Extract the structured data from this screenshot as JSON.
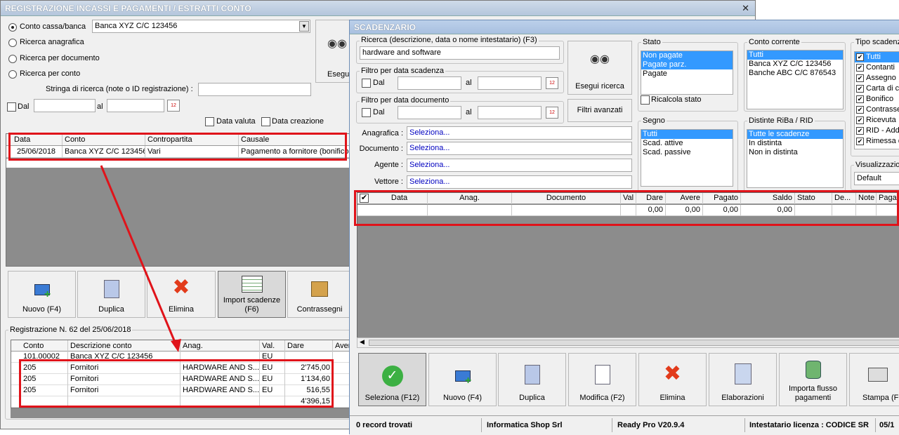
{
  "left_window": {
    "title": "REGISTRAZIONE INCASSI E PAGAMENTI / ESTRATTI CONTO",
    "radios": [
      "Conto cassa/banca",
      "Ricerca anagrafica",
      "Ricerca per documento",
      "Ricerca per conto"
    ],
    "conto_select": "Banca XYZ C/C 123456",
    "search_label": "Stringa di ricerca (note o ID registrazione) :",
    "dal": "Dal",
    "al": "al",
    "data_valuta": "Data valuta",
    "data_creazione": "Data creazione",
    "esegui": "Esegui",
    "grid_headers": [
      "Data",
      "Conto",
      "Contropartita",
      "Causale"
    ],
    "grid_row": [
      "25/06/2018",
      "Banca XYZ C/C 123456",
      "Vari",
      "Pagamento a fornitore (bonifico"
    ],
    "buttons": [
      "Nuovo (F4)",
      "Duplica",
      "Elimina",
      "Import scadenze\n(F6)",
      "Contrassegni"
    ],
    "reg_label": "Registrazione N. 62 del 25/06/2018",
    "reg_headers": [
      "Conto",
      "Descrizione conto",
      "Anag.",
      "Val.",
      "Dare",
      "Aver"
    ],
    "reg_rows": [
      [
        "101.00002",
        "Banca XYZ C/C 123456",
        "",
        "EU",
        "",
        ""
      ],
      [
        "205",
        "Fornitori",
        "HARDWARE AND S...",
        "EU",
        "2'745,00",
        ""
      ],
      [
        "205",
        "Fornitori",
        "HARDWARE AND S...",
        "EU",
        "1'134,60",
        ""
      ],
      [
        "205",
        "Fornitori",
        "HARDWARE AND S...",
        "EU",
        "516,55",
        ""
      ],
      [
        "",
        "",
        "",
        "",
        "4'396,15",
        ""
      ]
    ]
  },
  "scadenzario": {
    "title": "SCADENZARIO",
    "ricerca_label": "Ricerca (descrizione, data o nome intestatario) (F3)",
    "ricerca_value": "hardware and software",
    "filtro_scad": "Filtro per data scadenza",
    "filtro_doc": "Filtro per data documento",
    "dal": "Dal",
    "al": "al",
    "esegui_ricerca": "Esegui ricerca",
    "filtri_avanzati": "Filtri avanzati",
    "fields": [
      {
        "label": "Anagrafica :",
        "value": "Seleziona..."
      },
      {
        "label": "Documento :",
        "value": "Seleziona..."
      },
      {
        "label": "Agente :",
        "value": "Seleziona..."
      },
      {
        "label": "Vettore :",
        "value": "Seleziona..."
      }
    ],
    "stato": {
      "title": "Stato",
      "items": [
        "Non pagate",
        "Pagate parz.",
        "Pagate"
      ],
      "ricalcola": "Ricalcola stato"
    },
    "segno": {
      "title": "Segno",
      "items": [
        "Tutti",
        "Scad. attive",
        "Scad. passive"
      ]
    },
    "conto_corrente": {
      "title": "Conto corrente",
      "items": [
        "Tutti",
        "Banca XYZ C/C 123456",
        "Banche ABC C/C 876543"
      ]
    },
    "distinte": {
      "title": "Distinte RiBa / RID",
      "items": [
        "Tutte le scadenze",
        "In distinta",
        "Non in distinta"
      ]
    },
    "tipo": {
      "title": "Tipo scadenz",
      "items": [
        "Tutti",
        "Contanti",
        "Assegno",
        "Carta di c",
        "Bonifico",
        "Contrasse",
        "Ricevuta",
        "RID - Add",
        "Rimessa d"
      ]
    },
    "visualizzazione": {
      "title": "Visualizzazion",
      "value": "Default"
    },
    "grid_headers": [
      "Data",
      "Anag.",
      "Documento",
      "Val",
      "Dare",
      "Avere",
      "Pagato",
      "Saldo",
      "Stato",
      "De...",
      "Note",
      "Pagamen"
    ],
    "grid_totals": [
      "0,00",
      "0,00",
      "0,00",
      "0,00"
    ],
    "buttons": [
      "Seleziona (F12)",
      "Nuovo (F4)",
      "Duplica",
      "Modifica (F2)",
      "Elimina",
      "Elaborazioni",
      "Importa flusso\npagamenti",
      "Stampa (F9"
    ],
    "status": [
      "0 record trovati",
      "Informatica Shop Srl",
      "Ready Pro V20.9.4",
      "Intestatario licenza : CODICE SR",
      "05/1"
    ]
  },
  "colors": {
    "accent": "#e0131a",
    "selection": "#3399ff",
    "grid_empty": "#8c8c8c"
  }
}
